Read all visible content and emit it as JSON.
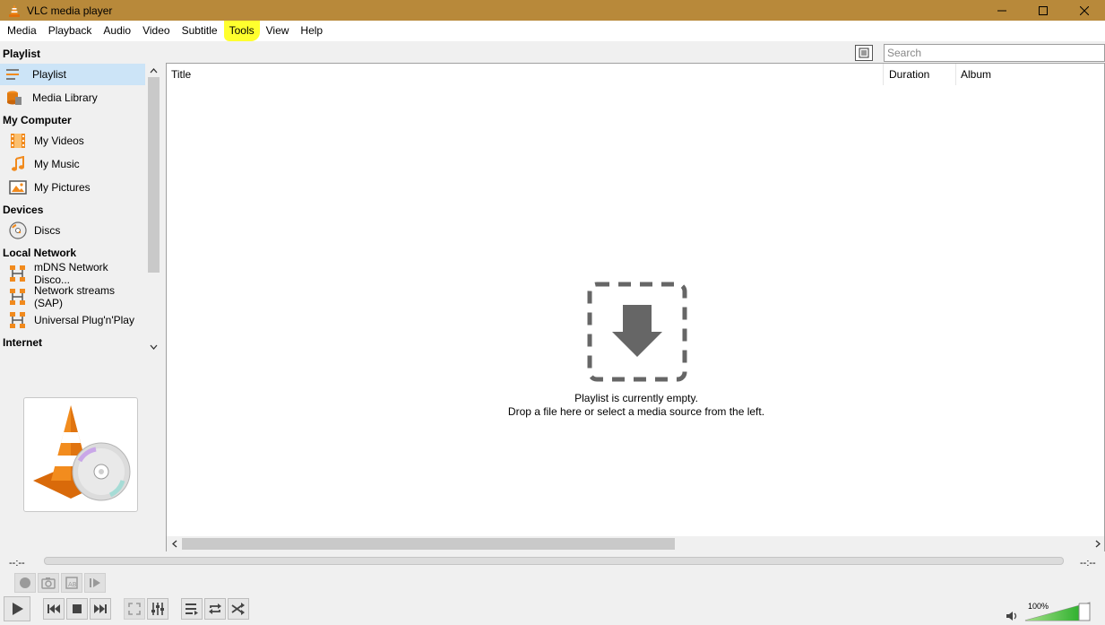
{
  "window": {
    "title": "VLC media player",
    "accent_color": "#b8893a"
  },
  "menubar": {
    "items": [
      {
        "label": "Media"
      },
      {
        "label": "Playback"
      },
      {
        "label": "Audio"
      },
      {
        "label": "Video"
      },
      {
        "label": "Subtitle"
      },
      {
        "label": "Tools",
        "highlighted": true
      },
      {
        "label": "View"
      },
      {
        "label": "Help"
      }
    ]
  },
  "sidebar": {
    "sections": {
      "playlist": "Playlist",
      "my_computer": "My Computer",
      "devices": "Devices",
      "local_network": "Local Network",
      "internet": "Internet"
    },
    "items": {
      "playlist": "Playlist",
      "media_library": "Media Library",
      "my_videos": "My Videos",
      "my_music": "My Music",
      "my_pictures": "My Pictures",
      "discs": "Discs",
      "mdns": "mDNS Network Disco...",
      "sap": "Network streams (SAP)",
      "upnp": "Universal Plug'n'Play"
    },
    "selected": "playlist"
  },
  "playlist": {
    "search_placeholder": "Search",
    "columns": {
      "title": "Title",
      "duration": "Duration",
      "album": "Album"
    },
    "empty_line1": "Playlist is currently empty.",
    "empty_line2": "Drop a file here or select a media source from the left."
  },
  "controls": {
    "elapsed": "--:--",
    "remaining": "--:--",
    "volume": "100%",
    "volume_level": 1.0,
    "icons": [
      "record-icon",
      "snapshot-icon",
      "loop-ab-icon",
      "frame-step-icon",
      "play-icon",
      "previous-icon",
      "stop-icon",
      "next-icon",
      "fullscreen-icon",
      "extended-settings-icon",
      "playlist-toggle-icon",
      "repeat-icon",
      "shuffle-icon",
      "speaker-icon"
    ]
  }
}
